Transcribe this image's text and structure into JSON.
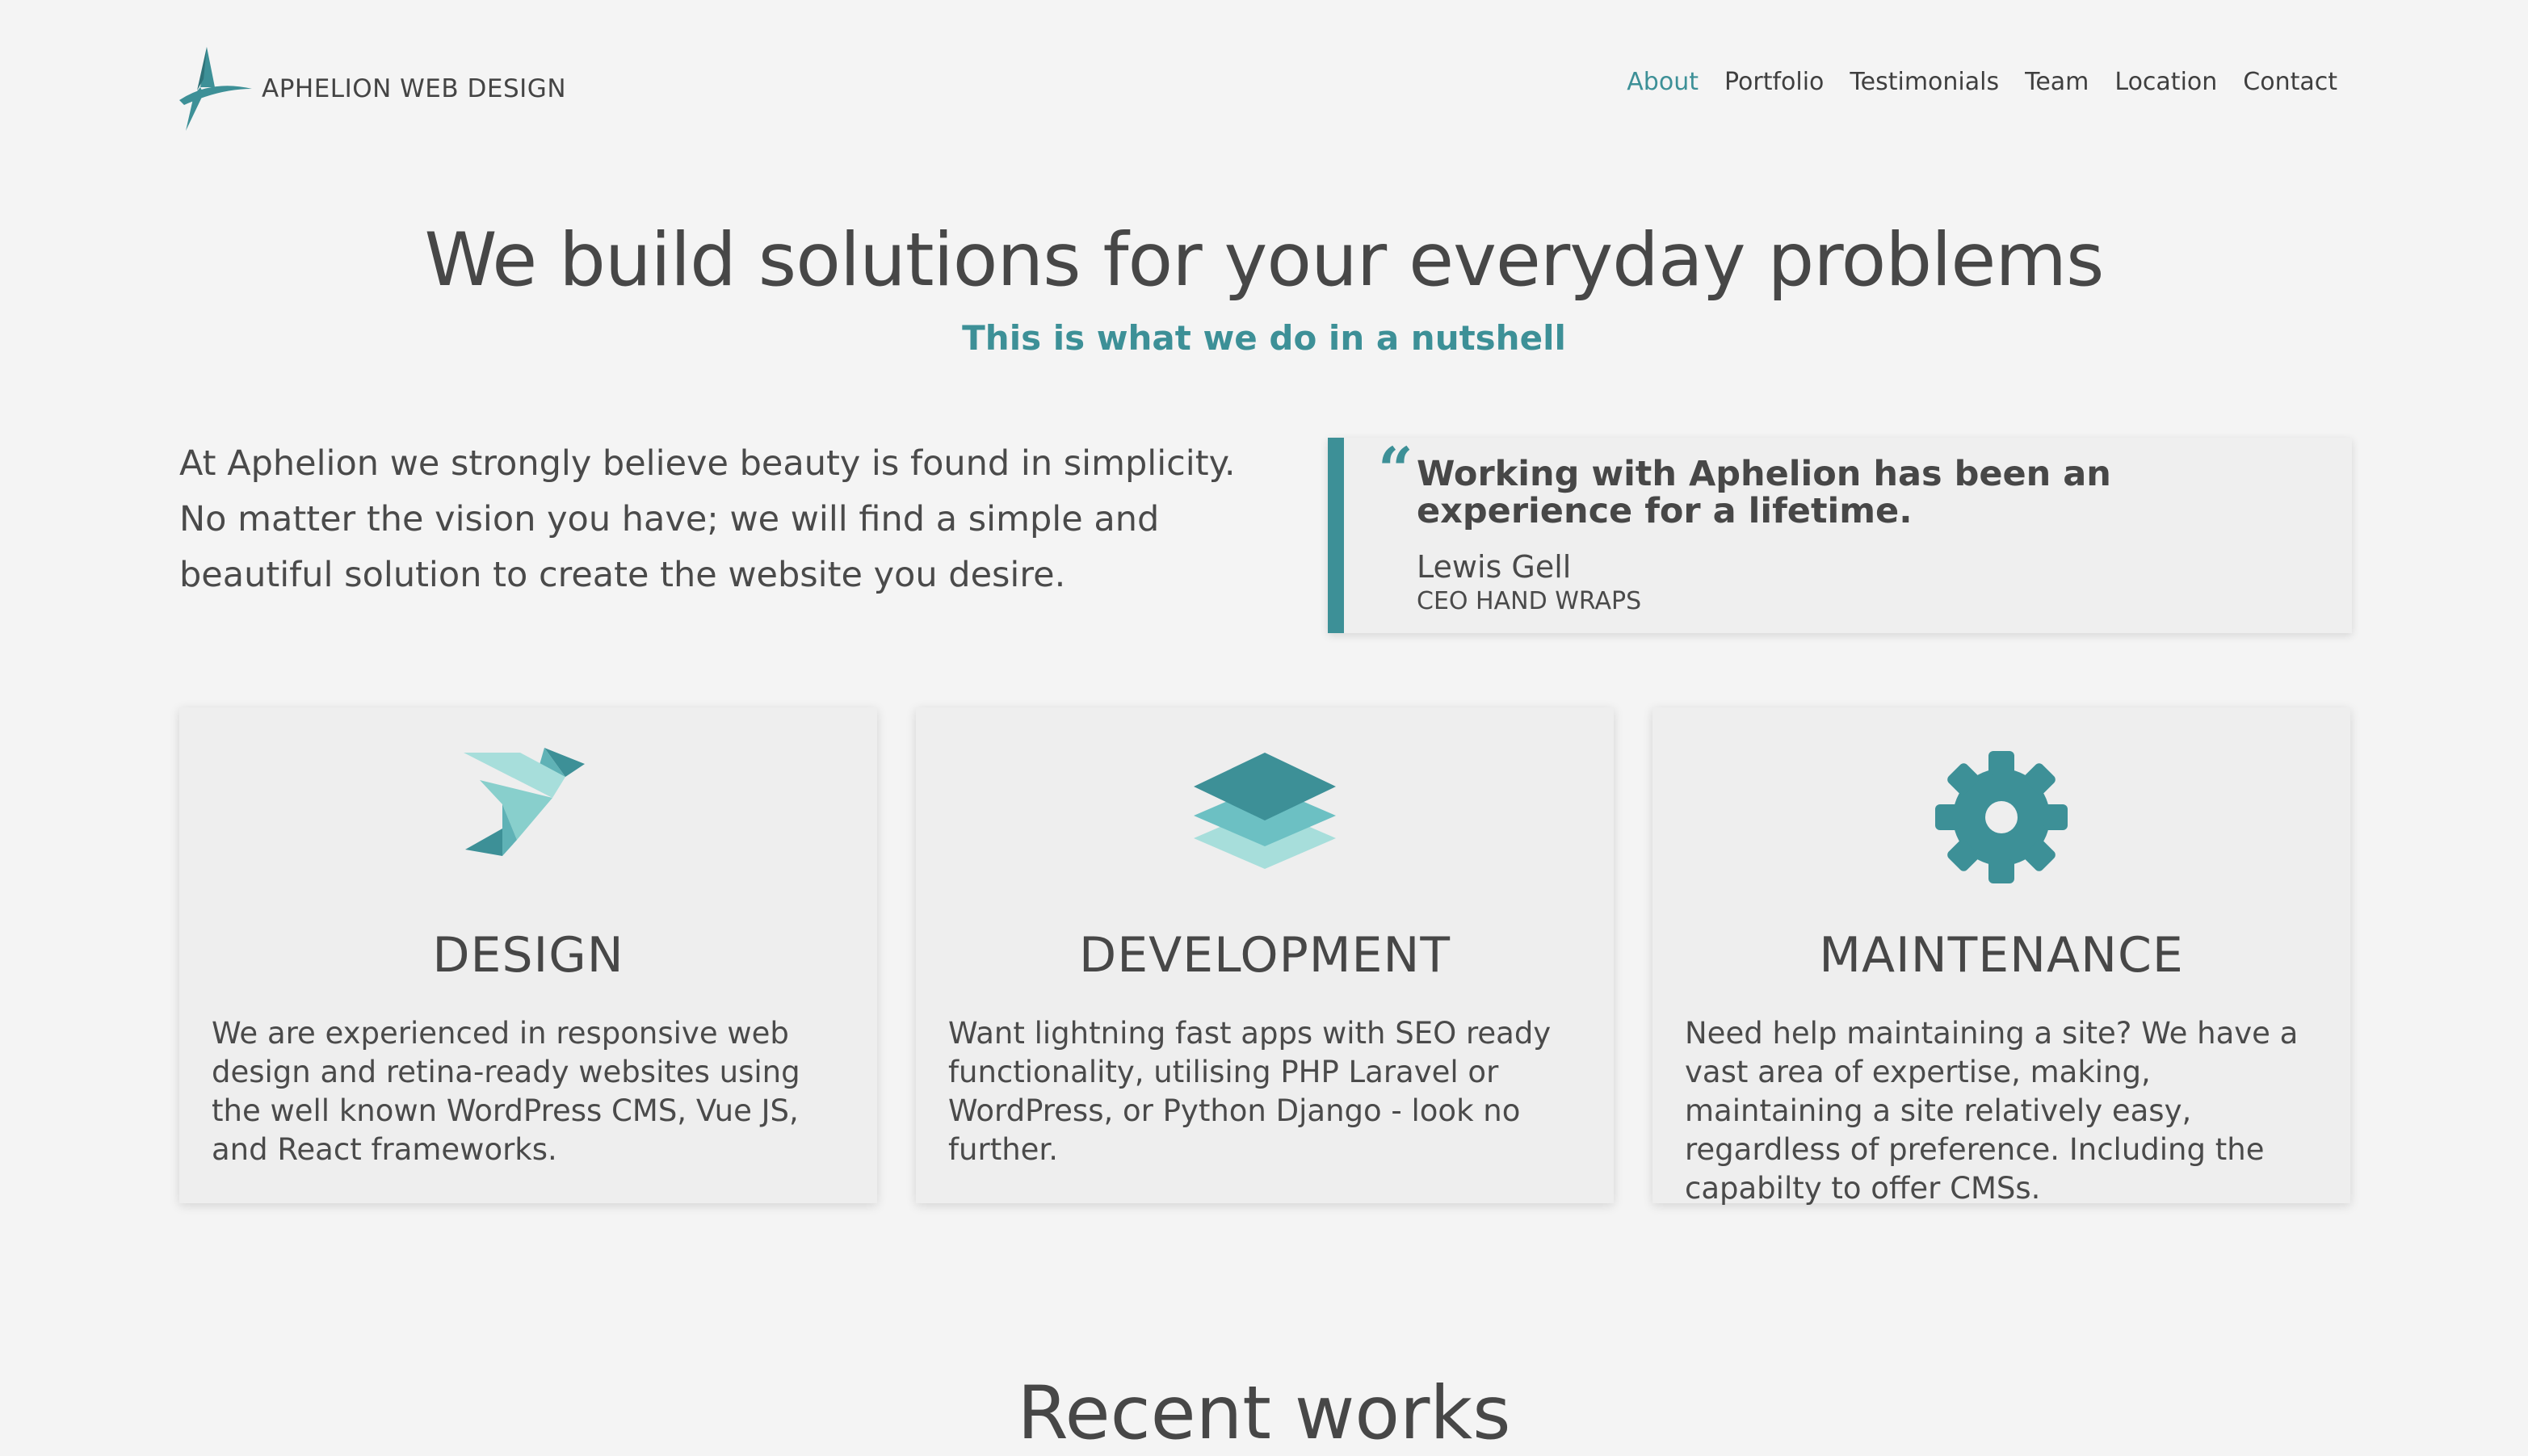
{
  "brand": {
    "name": "APHELION WEB DESIGN",
    "accent": "#3d9097"
  },
  "nav": {
    "items": [
      {
        "label": "About",
        "active": true
      },
      {
        "label": "Portfolio",
        "active": false
      },
      {
        "label": "Testimonials",
        "active": false
      },
      {
        "label": "Team",
        "active": false
      },
      {
        "label": "Location",
        "active": false
      },
      {
        "label": "Contact",
        "active": false
      }
    ]
  },
  "hero": {
    "title": "We build solutions for your everyday problems",
    "subtitle": "This is what we do in a nutshell"
  },
  "intro": {
    "text": "At Aphelion we strongly believe beauty is found in simplicity. No matter the vision you have; we will find a simple and beautiful solution to create the website you desire."
  },
  "testimonial": {
    "mark": "“",
    "quote": "Working with Aphelion has been an experience for a lifetime.",
    "author": "Lewis Gell",
    "role": "CEO HAND WRAPS"
  },
  "services": [
    {
      "icon": "origami-bird-icon",
      "title": "DESIGN",
      "text": "We are experienced in responsive web design and retina-ready websites using the well known WordPress CMS, Vue JS, and React frameworks."
    },
    {
      "icon": "layers-icon",
      "title": "DEVELOPMENT",
      "text": "Want lightning fast apps with SEO ready functionality, utilising PHP Laravel or WordPress, or Python Django - look no further."
    },
    {
      "icon": "gear-icon",
      "title": "MAINTENANCE",
      "text": "Need help maintaining a site? We have a vast area of expertise, making, maintaining a site relatively easy, regardless of preference. Including the capabilty to offer CMSs."
    }
  ],
  "recent": {
    "title": "Recent works"
  }
}
